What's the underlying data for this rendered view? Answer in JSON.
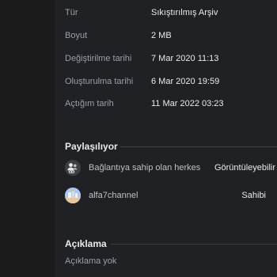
{
  "details": [
    {
      "label": "Tür",
      "value": "Sıkıştırılmış Arşiv"
    },
    {
      "label": "Boyut",
      "value": "2 MB"
    },
    {
      "label": "Değiştirilme tarihi",
      "value": "7 Mar 2020 11:13"
    },
    {
      "label": "Oluşturulma tarihi",
      "value": "6 Mar 2020 19:59"
    },
    {
      "label": "Açtığım tarih",
      "value": "11 Mar 2022 03:23"
    }
  ],
  "sharing": {
    "title": "Paylaşılıyor",
    "entries": [
      {
        "name": "Bağlantıya sahip olan herkes",
        "role": "Görüntüleyebilir",
        "icon": "link-people-icon"
      },
      {
        "name": "alfa7channel",
        "role": "Sahibi",
        "icon": "user-avatar"
      }
    ]
  },
  "description": {
    "title": "Açıklama",
    "text": "Açıklama yok"
  },
  "colors": {
    "background": "#202124",
    "text_primary": "#e8eaed",
    "text_secondary": "#9aa0a6",
    "divider": "#3c4043"
  }
}
